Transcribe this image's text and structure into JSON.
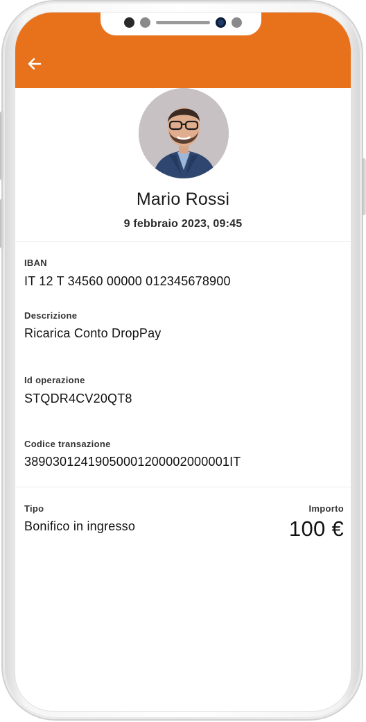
{
  "appbar": {
    "color": "#e8711b",
    "back_icon": "arrow-left-icon"
  },
  "profile": {
    "name": "Mario Rossi",
    "date": "9 febbraio 2023, 09:45",
    "avatar_icon": "user-photo"
  },
  "details": {
    "iban": {
      "label": "IBAN",
      "value": "IT 12 T 34560 00000 012345678900"
    },
    "description": {
      "label": "Descrizione",
      "value": "Ricarica Conto DropPay"
    },
    "operation_id": {
      "label": "Id operazione",
      "value": "STQDR4CV20QT8"
    },
    "transaction_code": {
      "label": "Codice transazione",
      "value": "38903012419050001200002000001IT"
    }
  },
  "summary": {
    "type_label": "Tipo",
    "type_value": "Bonifico in ingresso",
    "amount_label": "Importo",
    "amount_value": "100 €"
  }
}
